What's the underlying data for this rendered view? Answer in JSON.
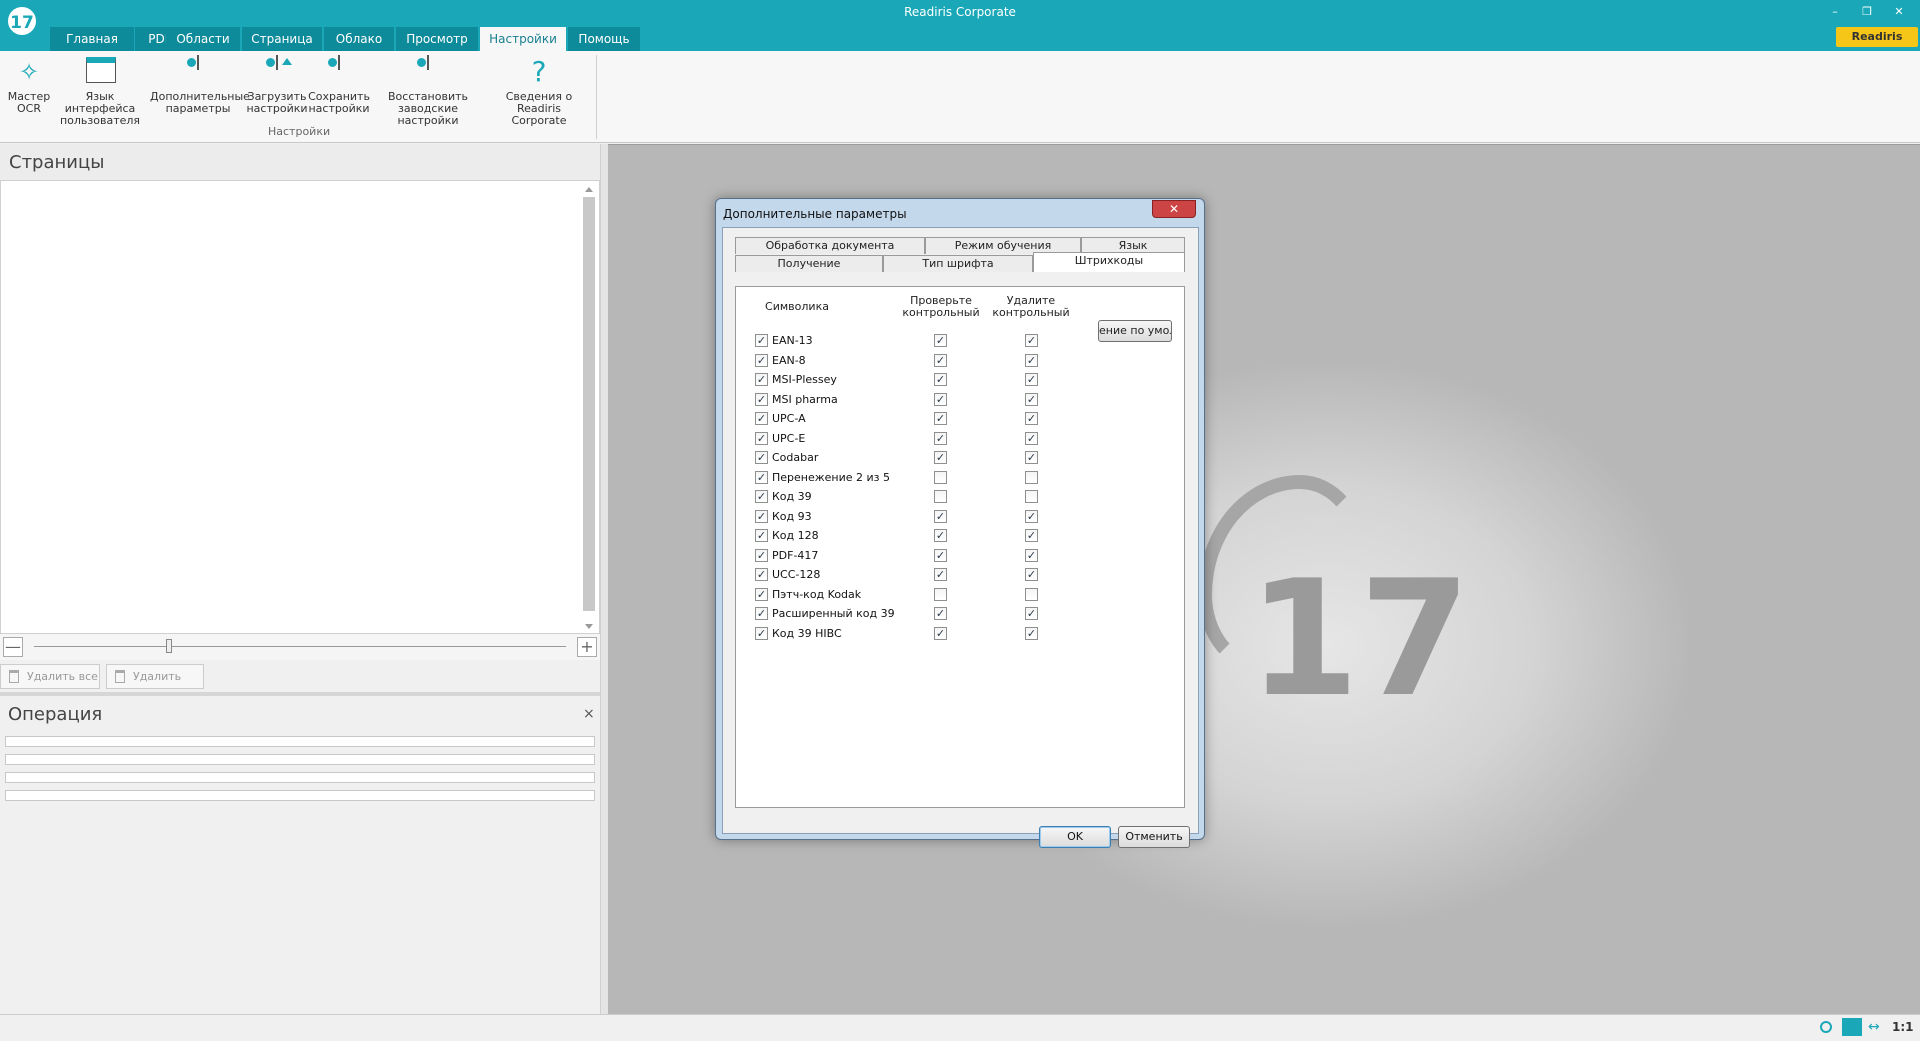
{
  "window": {
    "title": "Readiris Corporate",
    "logo_text": "17",
    "controls": {
      "minimize": "–",
      "maximize": "❐",
      "close": "✕"
    }
  },
  "ribbon": {
    "tabs": [
      {
        "label": "Главная",
        "active": false
      },
      {
        "label": "PDF",
        "active": false
      },
      {
        "label": "Области",
        "active": false
      },
      {
        "label": "Страница",
        "active": false
      },
      {
        "label": "Облако",
        "active": false
      },
      {
        "label": "Просмотр",
        "active": false
      },
      {
        "label": "Настройки",
        "active": true
      },
      {
        "label": "Помощь",
        "active": false
      }
    ],
    "store_label": "Readiris Store",
    "buttons": [
      {
        "label": "Мастер\nOCR",
        "icon": "wand-icon"
      },
      {
        "label": "Язык интерфейса\nпользователя",
        "icon": "language-window-icon"
      },
      {
        "label": "Дополнительные\nпараметры",
        "icon": "settings-doc-icon"
      },
      {
        "label": "Загрузить\nнастройки",
        "icon": "load-settings-icon"
      },
      {
        "label": "Сохранить\nнастройки",
        "icon": "save-settings-icon"
      },
      {
        "label": "Восстановить\nзаводские настройки",
        "icon": "restore-settings-icon"
      },
      {
        "label": "Сведения о\nReadiris Corporate",
        "icon": "question-icon"
      }
    ],
    "group_label": "Настройки"
  },
  "pages_panel": {
    "title": "Страницы",
    "delete_all": "Удалить все",
    "delete": "Удалить",
    "zoom_minus": "—",
    "zoom_plus": "+"
  },
  "operation_panel": {
    "title": "Операция",
    "close": "×"
  },
  "viewer": {
    "logo_text": "17"
  },
  "statusbar": {
    "zoom_ratio": "1:1"
  },
  "dialog": {
    "title": "Дополнительные параметры",
    "close": "✕",
    "tabs_row1": [
      "Обработка документа",
      "Режим обучения",
      "Язык"
    ],
    "tabs_row2": [
      "Получение",
      "Тип шрифта",
      "Штрихкоды"
    ],
    "active_tab": "Штрихкоды",
    "default_button": "ение по умолч",
    "columns": {
      "symbology": "Символика",
      "verify": "Проверьте\nконтрольный",
      "remove": "Удалите\nконтрольный"
    },
    "barcodes": [
      {
        "name": "EAN-13",
        "enabled": true,
        "verify": true,
        "remove": true
      },
      {
        "name": "EAN-8",
        "enabled": true,
        "verify": true,
        "remove": true
      },
      {
        "name": "MSI-Plessey",
        "enabled": true,
        "verify": true,
        "remove": true
      },
      {
        "name": "MSI pharma",
        "enabled": true,
        "verify": true,
        "remove": true
      },
      {
        "name": "UPC-A",
        "enabled": true,
        "verify": true,
        "remove": true
      },
      {
        "name": "UPC-E",
        "enabled": true,
        "verify": true,
        "remove": true
      },
      {
        "name": "Codabar",
        "enabled": true,
        "verify": true,
        "remove": true
      },
      {
        "name": "Перенежение 2 из 5",
        "enabled": true,
        "verify": false,
        "remove": false
      },
      {
        "name": "Код 39",
        "enabled": true,
        "verify": false,
        "remove": false
      },
      {
        "name": "Код 93",
        "enabled": true,
        "verify": true,
        "remove": true
      },
      {
        "name": "Код 128",
        "enabled": true,
        "verify": true,
        "remove": true
      },
      {
        "name": "PDF-417",
        "enabled": true,
        "verify": true,
        "remove": true
      },
      {
        "name": "UCC-128",
        "enabled": true,
        "verify": true,
        "remove": true
      },
      {
        "name": "Пэтч-код Kodak",
        "enabled": true,
        "verify": false,
        "remove": false
      },
      {
        "name": "Расширенный код 39",
        "enabled": true,
        "verify": true,
        "remove": true
      },
      {
        "name": "Код 39 HIBC",
        "enabled": true,
        "verify": true,
        "remove": true
      }
    ],
    "ok": "OK",
    "cancel": "Отменить"
  }
}
